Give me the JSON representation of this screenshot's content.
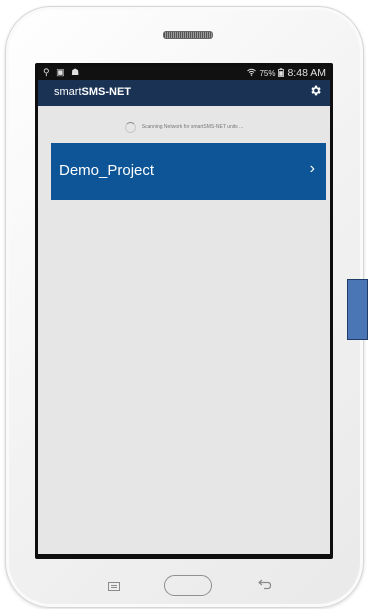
{
  "statusbar": {
    "left_icons": "⚲ ▣ ☗",
    "left_icon_names": [
      "usb-icon",
      "gallery-icon",
      "notification-icon"
    ],
    "battery": "75%",
    "time": "8:48 AM"
  },
  "appbar": {
    "title_prefix": "smart",
    "title_bold": "SMS-NET",
    "settings_icon": "gear-icon"
  },
  "scan": {
    "text": "Scanning Network for smartSMS-NET units ..."
  },
  "project": {
    "name": "Demo_Project",
    "chevron": "›"
  },
  "colors": {
    "appbar": "#1a3355",
    "project_tile": "#0d5596",
    "background": "#e6e6e6",
    "side_button": "#4a76b5"
  }
}
